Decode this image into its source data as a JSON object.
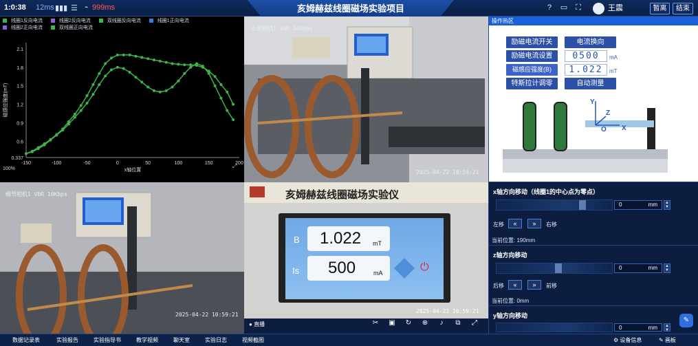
{
  "topbar": {
    "clock": "1:0:38",
    "latency": "12ms",
    "rtt": "999ms",
    "title": "亥姆赫兹线圈磁场实验项目",
    "user": "王震",
    "btn_leave": "暂离",
    "btn_end": "结束"
  },
  "chart_data": {
    "type": "line",
    "legend": [
      "线圈1反向电流",
      "线圈2反向电流",
      "双线圈反向电流",
      "线圈1正向电流",
      "线圈2正向电流",
      "双线圈正向电流"
    ],
    "legend_colors": [
      "#3db44b",
      "#8c64d8",
      "#3db44b",
      "#2f7fe0",
      "#8c64d8",
      "#3db44b"
    ],
    "xlabel": "x轴位置",
    "ylabel": "磁感应强度(mT)",
    "xlim": [
      -150,
      200
    ],
    "ylim": [
      0.337,
      2.2
    ],
    "xticks": [
      -150,
      -100,
      -50,
      0,
      50,
      100,
      150,
      200
    ],
    "yticks": [
      "0.337",
      "0.6",
      "0.9",
      "1.2",
      "1.5",
      "1.8",
      "2.1"
    ],
    "series": [
      {
        "x": [
          -150,
          -140,
          -130,
          -120,
          -110,
          -100,
          -90,
          -80,
          -70,
          -60,
          -50,
          -40,
          -30,
          -20,
          -10,
          0,
          10,
          20,
          30,
          40,
          50,
          60,
          70,
          80,
          90,
          100,
          110,
          120,
          130,
          140,
          150,
          160,
          170,
          180,
          190
        ],
        "values": [
          0.4,
          0.44,
          0.5,
          0.56,
          0.63,
          0.71,
          0.8,
          0.92,
          1.04,
          1.18,
          1.34,
          1.52,
          1.7,
          1.86,
          1.95,
          2.0,
          2.0,
          2.0,
          1.98,
          1.96,
          1.94,
          1.92,
          1.9,
          1.88,
          1.86,
          1.85,
          1.84,
          1.84,
          1.83,
          1.8,
          1.74,
          1.65,
          1.52,
          1.4,
          1.2
        ]
      },
      {
        "x": [
          -150,
          -140,
          -130,
          -120,
          -110,
          -100,
          -90,
          -80,
          -70,
          -60,
          -50,
          -40,
          -30,
          -20,
          -10,
          0,
          10,
          20,
          30,
          40,
          50,
          60,
          70,
          80,
          90,
          100,
          110,
          120,
          130,
          140,
          150,
          160,
          170,
          180,
          190
        ],
        "values": [
          0.4,
          0.43,
          0.48,
          0.54,
          0.62,
          0.7,
          0.78,
          0.88,
          0.99,
          1.1,
          1.22,
          1.36,
          1.52,
          1.66,
          1.76,
          1.8,
          1.78,
          1.72,
          1.64,
          1.56,
          1.48,
          1.42,
          1.4,
          1.42,
          1.48,
          1.58,
          1.7,
          1.8,
          1.86,
          1.82,
          1.7,
          1.5,
          1.3,
          1.1,
          0.95
        ]
      }
    ]
  },
  "chart_extra": {
    "corner": "100%",
    "button": "编辑"
  },
  "cams": {
    "cam1": {
      "label": "全景相机1 VBR 24Kbps",
      "time": "2025-04-22   10:59:21"
    },
    "cam2": {
      "label": "细节相机1 VBR 10Kbps",
      "time": "2025-04-22   10:59:21"
    },
    "cam3": {
      "label": "亥姆赫兹线圈磁场实验仪",
      "b_label": "B",
      "b_val": "1.022",
      "b_unit": "mT",
      "i_label": "Is",
      "i_val": "500",
      "i_unit": "mA",
      "time": "2025-04-22   10:59:21",
      "live": "直播"
    }
  },
  "ops": {
    "head": "操作热区",
    "btn1": "励磁电流开关",
    "btn2": "电流换向",
    "lbl_current": "励磁电流设置",
    "current_val": "0500",
    "current_unit": "mA",
    "lbl_b": "磁感应强度(B)",
    "b_val": "1.022",
    "b_unit": "mT",
    "btn3": "特斯拉计调零",
    "btn4": "自动测量",
    "axis_y": "Y",
    "axis_z": "Z",
    "axis_o": "O",
    "axis_x": "X"
  },
  "xmove": {
    "title": "x轴方向移动（线圈1的中心点为零点）",
    "val": "0",
    "unit": "mm",
    "left": "左移",
    "right": "右移",
    "pos": "当前位置: 190mm"
  },
  "zmove": {
    "title": "z轴方向移动",
    "val": "0",
    "unit": "mm",
    "back": "后移",
    "fwd": "前移",
    "pos": "当前位置: 0mm"
  },
  "ymove": {
    "title": "y轴方向移动",
    "val": "0",
    "unit": "mm"
  },
  "bottom": {
    "nav": [
      "数据记录表",
      "实验报告",
      "实验指导书",
      "教学视频",
      "聊天室",
      "实验日志",
      "视频截图"
    ],
    "device": "设备信息",
    "board": "画板"
  }
}
